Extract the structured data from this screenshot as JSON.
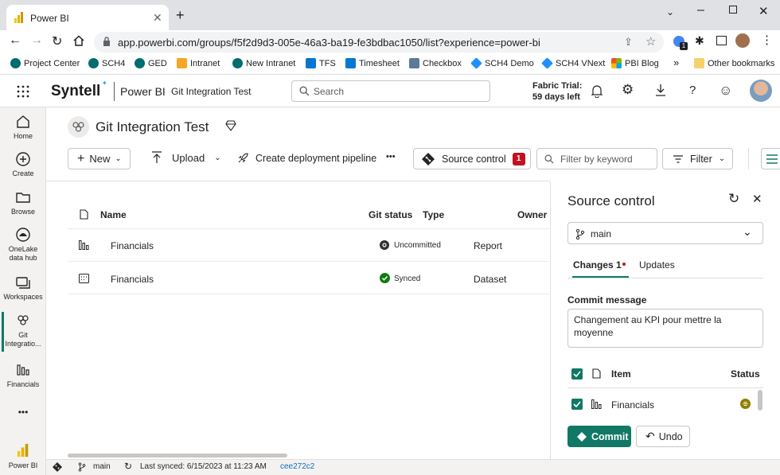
{
  "browser": {
    "tab_title": "Power BI",
    "url": "app.powerbi.com/groups/f5f2d9d3-005e-46a3-ba19-fe3bdbac1050/list?experience=power-bi",
    "bookmarks": [
      "Project Center",
      "SCH4",
      "GED",
      "Intranet",
      "New Intranet",
      "TFS",
      "Timesheet",
      "Checkbox",
      "SCH4 Demo",
      "SCH4 VNext",
      "PBI Blog"
    ],
    "bookmarks_more": "»",
    "other_bookmarks": "Other bookmarks",
    "extension_badge": "1"
  },
  "header": {
    "brand": "Syntell",
    "product": "Power BI",
    "workspace": "Git Integration Test",
    "search_placeholder": "Search",
    "trial_line1": "Fabric Trial:",
    "trial_line2": "59 days left"
  },
  "leftnav": {
    "items": [
      "Home",
      "Create",
      "Browse",
      "OneLake data hub",
      "Workspaces",
      "Git Integratio...",
      "Financials"
    ],
    "more": "•••",
    "footer": "Power BI"
  },
  "workspace": {
    "title": "Git Integration Test",
    "toolbar": {
      "new": "New",
      "upload": "Upload",
      "pipeline": "Create deployment pipeline",
      "more": "•••",
      "source_control": "Source control",
      "source_control_count": "1",
      "filter_placeholder": "Filter by keyword",
      "filter": "Filter"
    },
    "columns": {
      "name": "Name",
      "git_status": "Git status",
      "type": "Type",
      "owner": "Owner"
    },
    "rows": [
      {
        "name": "Financials",
        "status": "Uncommitted",
        "type": "Report"
      },
      {
        "name": "Financials",
        "status": "Synced",
        "type": "Dataset"
      }
    ]
  },
  "source_control": {
    "title": "Source control",
    "branch": "main",
    "tabs": {
      "changes": "Changes 1",
      "updates": "Updates"
    },
    "commit_label": "Commit message",
    "commit_message": "Changement au KPI pour mettre la moyenne",
    "table": {
      "item": "Item",
      "status": "Status"
    },
    "items": [
      {
        "name": "Financials"
      }
    ],
    "commit_button": "Commit",
    "undo_button": "Undo"
  },
  "statusbar": {
    "branch": "main",
    "last_synced": "Last synced: 6/15/2023 at 11:23 AM",
    "commit": "cee272c2"
  },
  "colors": {
    "accent": "#117865",
    "badge": "#c50f1f",
    "tabstrip": "#dfe1e5"
  }
}
